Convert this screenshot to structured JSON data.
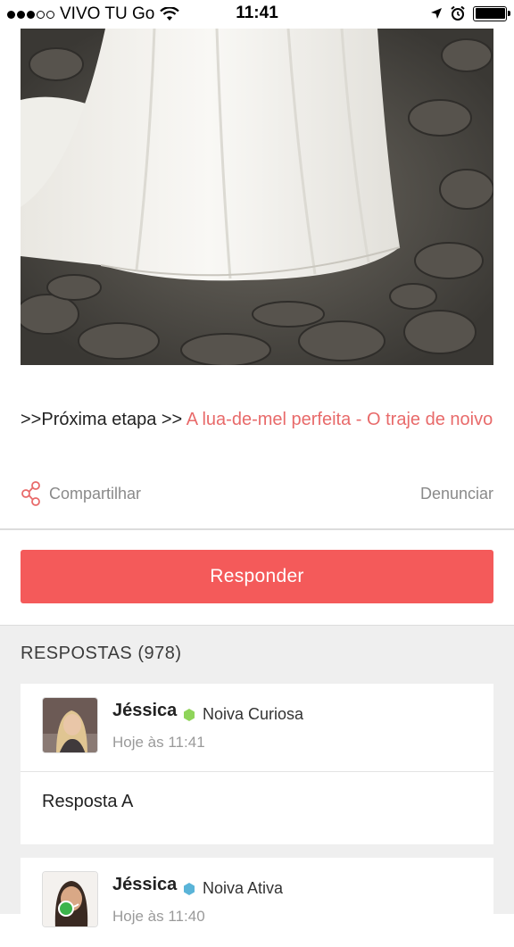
{
  "status_bar": {
    "carrier": "VIVO TU Go",
    "time": "11:41"
  },
  "photo": {
    "description_icon": "wedding-dress-photo"
  },
  "post": {
    "next_step_prefix": ">>Próxima etapa >> ",
    "next_step_link": "A lua-de-mel perfeita - O traje de noivo",
    "share_label": "Compartilhar",
    "report_label": "Denunciar"
  },
  "reply_button": "Responder",
  "answers": {
    "title": "RESPOSTAS (978)",
    "items": [
      {
        "name": "Jéssica",
        "badge": "Noiva Curiosa",
        "badge_color": "#8fd45a",
        "time": "Hoje às 11:41",
        "text": "Resposta A"
      },
      {
        "name": "Jéssica",
        "badge": "Noiva Ativa",
        "badge_color": "#5ab4d8",
        "time": "Hoje às 11:40",
        "text": ""
      }
    ]
  },
  "colors": {
    "accent": "#f45a5a",
    "link": "#e86a6a"
  }
}
